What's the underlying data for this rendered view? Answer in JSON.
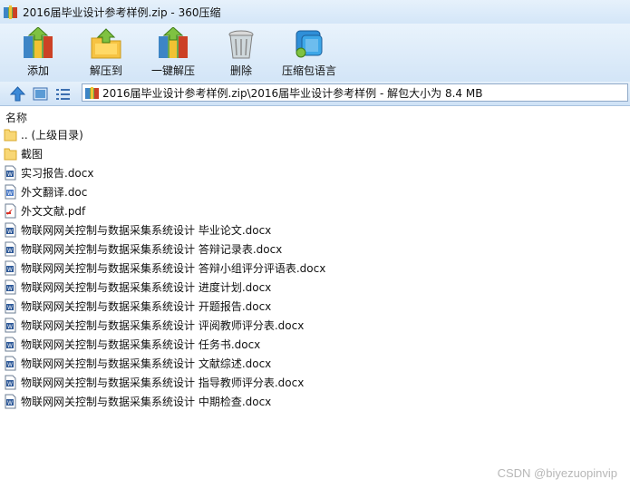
{
  "window": {
    "title": "2016届毕业设计参考样例.zip - 360压缩"
  },
  "toolbar": {
    "add": "添加",
    "extract_to": "解压到",
    "one_click_extract": "一键解压",
    "delete": "删除",
    "language": "压缩包语言"
  },
  "address": {
    "path": "2016届毕业设计参考样例.zip\\2016届毕业设计参考样例 - 解包大小为 8.4 MB"
  },
  "list": {
    "header_name": "名称",
    "items": [
      {
        "name": ".. (上级目录)",
        "type": "folder"
      },
      {
        "name": "截图",
        "type": "folder"
      },
      {
        "name": "实习报告.docx",
        "type": "word"
      },
      {
        "name": "外文翻译.doc",
        "type": "word-doc"
      },
      {
        "name": "外文文献.pdf",
        "type": "pdf"
      },
      {
        "name": "物联网网关控制与数据采集系统设计 毕业论文.docx",
        "type": "word"
      },
      {
        "name": "物联网网关控制与数据采集系统设计 答辩记录表.docx",
        "type": "word"
      },
      {
        "name": "物联网网关控制与数据采集系统设计 答辩小组评分评语表.docx",
        "type": "word"
      },
      {
        "name": "物联网网关控制与数据采集系统设计 进度计划.docx",
        "type": "word"
      },
      {
        "name": "物联网网关控制与数据采集系统设计 开题报告.docx",
        "type": "word"
      },
      {
        "name": "物联网网关控制与数据采集系统设计 评阅教师评分表.docx",
        "type": "word"
      },
      {
        "name": "物联网网关控制与数据采集系统设计 任务书.docx",
        "type": "word"
      },
      {
        "name": "物联网网关控制与数据采集系统设计 文献综述.docx",
        "type": "word"
      },
      {
        "name": "物联网网关控制与数据采集系统设计 指导教师评分表.docx",
        "type": "word"
      },
      {
        "name": "物联网网关控制与数据采集系统设计 中期检查.docx",
        "type": "word"
      }
    ]
  },
  "watermark": "CSDN @biyezuopinvip"
}
